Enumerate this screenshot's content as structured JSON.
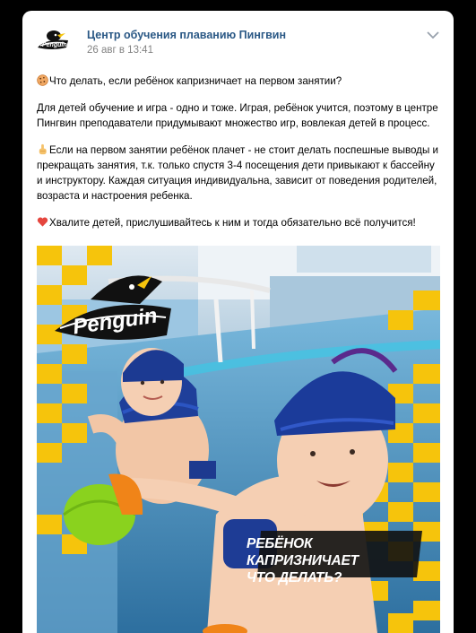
{
  "post": {
    "author": "Центр обучения плаванию Пингвин",
    "date": "26 авг в 13:41",
    "menu_icon": "chevron-down-icon"
  },
  "content": {
    "line1": "Что делать, если ребёнок капризничает на первом занятии?",
    "para2": "Для детей обучение и игра - одно и тоже. Играя, ребёнок учится, поэтому в центре Пингвин преподаватели придумывают множество игр, вовлекая детей в процесс.",
    "para3": "Если на первом занятии ребёнок плачет - не стоит делать поспешные выводы и прекращать занятия, т.к. только спустя 3-4 посещения дети привыкают к бассейну и инструктору. Каждая ситуация индивидуальна, зависит от поведения родителей, возраста и настроения ребенка.",
    "para4": "Хвалите детей, прислушивайтесь к ним и тогда обязательно всё получится!"
  },
  "image": {
    "logo_text": "Penguin",
    "caption_line1": "РЕБЁНОК КАПРИЗНИЧАЕТ",
    "caption_line2": "ЧТО ДЕЛАТЬ?"
  },
  "colors": {
    "link": "#2a5885",
    "meta": "#828282",
    "accent_yellow": "#f6c40c",
    "pool": "#5aa9d6"
  }
}
